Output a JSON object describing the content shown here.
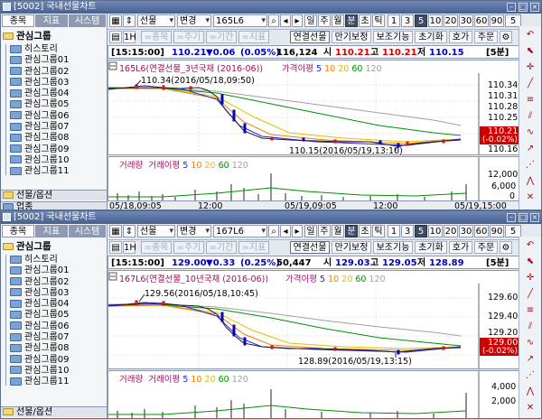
{
  "windows": [
    {
      "title": "[5002] 국내선물차트",
      "sidebar": {
        "tabs": [
          "종목",
          "지표",
          "시스템"
        ],
        "group_header": "관심그룹",
        "items": [
          "히스토리",
          "관심그룹01",
          "관심그룹02",
          "관심그룹03",
          "관심그룹04",
          "관심그룹05",
          "관심그룹06",
          "관심그룹07",
          "관심그룹08",
          "관심그룹09",
          "관심그룹10",
          "관심그룹11"
        ],
        "footer": [
          "선물/옵션",
          "업종"
        ]
      },
      "toolbar": {
        "select_type": "선물",
        "change": "변경",
        "code": "165L6",
        "periods": [
          "일",
          "주",
          "월",
          "분",
          "초",
          "틱"
        ],
        "intervals": [
          "1",
          "3",
          "5",
          "10",
          "20",
          "30",
          "60",
          "90",
          "5"
        ]
      },
      "toolbar2": {
        "buttons": [
          "종목",
          "주기",
          "기간",
          "지표",
          "연결선물",
          "만기보정",
          "보조기능",
          "초기화",
          "호가",
          "주문"
        ]
      },
      "quote": {
        "time": "[15:15:00]",
        "price": "110.21",
        "change": "▼0.06",
        "rate": "(0.05%)",
        "volume": "116,124",
        "open_label": "시",
        "open": "110.21",
        "high_label": "고",
        "high": "110.21",
        "low_label": "저",
        "low": "110.15",
        "period": "[5분]"
      },
      "chart": {
        "legend_code": "165L6(연결선물_3년국채 (2016-06))",
        "legend_ma": "가격이평",
        "ma_periods": [
          "5",
          "10",
          "20",
          "60",
          "120"
        ],
        "ma_colors": [
          "#2020ff",
          "#f08000",
          "#e0c000",
          "#009000",
          "#a0a0a0"
        ],
        "high_annot": "110.34(2016/05/18,09:50)",
        "low_annot": "110.15(2016/05/19,13:10)",
        "price_ticks": [
          "110.34",
          "110.31",
          "110.28",
          "110.25",
          "110.16"
        ],
        "price_box": "110.21",
        "price_box_pct": "(-0.02%)",
        "vol_legend": "거래량",
        "vol_ma": "거래이평",
        "vol_ticks": [
          "12,000",
          "6,000",
          "0"
        ],
        "x_ticks": [
          "05/18,09:05",
          "12:00",
          "05/19,09:05",
          "12:00",
          "05/19,15:00"
        ]
      }
    },
    {
      "title": "[5002] 국내선물차트",
      "sidebar": {
        "tabs": [
          "종목",
          "지표",
          "시스템"
        ],
        "group_header": "관심그룹",
        "items": [
          "히스토리",
          "관심그룹01",
          "관심그룹02",
          "관심그룹03",
          "관심그룹04",
          "관심그룹05",
          "관심그룹06",
          "관심그룹07",
          "관심그룹08",
          "관심그룹09",
          "관심그룹10",
          "관심그룹11"
        ],
        "footer": [
          "선물/옵션"
        ]
      },
      "toolbar": {
        "select_type": "선물",
        "change": "변경",
        "code": "167L6",
        "periods": [
          "일",
          "주",
          "월",
          "분",
          "초",
          "틱"
        ],
        "intervals": [
          "1",
          "3",
          "5",
          "10",
          "20",
          "30",
          "60",
          "90",
          "5"
        ]
      },
      "toolbar2": {
        "buttons": [
          "종목",
          "주기",
          "기간",
          "지표",
          "연결선물",
          "만기보정",
          "보조기능",
          "초기화",
          "호가",
          "주문"
        ]
      },
      "quote": {
        "time": "[15:15:00]",
        "price": "129.00",
        "change": "▼0.33",
        "rate": "(0.25%)",
        "volume": "50,447",
        "open_label": "시",
        "open": "129.03",
        "high_label": "고",
        "high": "129.05",
        "low_label": "저",
        "low": "128.89",
        "period": "[5분]"
      },
      "chart": {
        "legend_code": "167L6(연결선물_10년국채 (2016-06))",
        "legend_ma": "가격이평",
        "ma_periods": [
          "5",
          "10",
          "20",
          "60",
          "120"
        ],
        "ma_colors": [
          "#2020ff",
          "#f08000",
          "#e0c000",
          "#009000",
          "#a0a0a0"
        ],
        "high_annot": "129.56(2016/05/18,10:45)",
        "low_annot": "128.89(2016/05/19,13:15)",
        "price_ticks": [
          "129.60",
          "129.40",
          "129.20"
        ],
        "price_box": "129.00",
        "price_box_pct": "(-0.02%)",
        "vol_legend": "거래량",
        "vol_ma": "거래이평",
        "vol_ticks": [
          "4,000",
          "2,000"
        ]
      }
    }
  ]
}
